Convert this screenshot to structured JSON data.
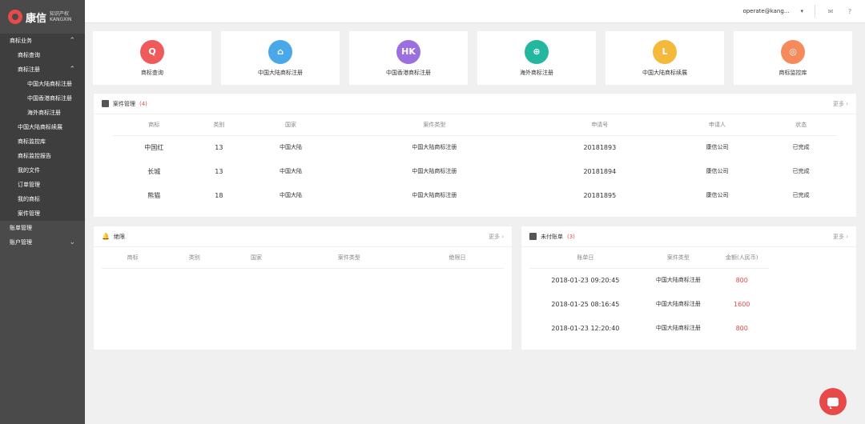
{
  "brand": {
    "name": "康信",
    "sub1": "知识产权",
    "sub2": "KANGXIN"
  },
  "nav": [
    {
      "label": "商标业务",
      "level": "group",
      "chev": "⌃"
    },
    {
      "label": "商标查询",
      "level": "l2"
    },
    {
      "label": "商标注册",
      "level": "l2",
      "chev": "⌃"
    },
    {
      "label": "中国大陆商标注册",
      "level": "l3"
    },
    {
      "label": "中国香港商标注册",
      "level": "l3"
    },
    {
      "label": "海外商标注册",
      "level": "l3"
    },
    {
      "label": "中国大陆商标续展",
      "level": "l2"
    },
    {
      "label": "商标监控库",
      "level": "l2"
    },
    {
      "label": "商标监控报告",
      "level": "l2"
    },
    {
      "label": "我的文件",
      "level": "l2"
    },
    {
      "label": "订单管理",
      "level": "l2"
    },
    {
      "label": "我的商标",
      "level": "l2"
    },
    {
      "label": "案件管理",
      "level": "l2"
    },
    {
      "label": "账单管理",
      "level": "top"
    },
    {
      "label": "账户管理",
      "level": "top",
      "chev": "⌄"
    }
  ],
  "topbar": {
    "user": "operate@kang...",
    "caret": "▾"
  },
  "quick": [
    {
      "label": "商标查询",
      "color": "#ef5b5b",
      "glyph": "Q"
    },
    {
      "label": "中国大陆商标注册",
      "color": "#4aa8e8",
      "glyph": "⌂"
    },
    {
      "label": "中国香港商标注册",
      "color": "#9c6fe0",
      "glyph": "HK"
    },
    {
      "label": "海外商标注册",
      "color": "#23b7a0",
      "glyph": "⊕"
    },
    {
      "label": "中国大陆商标续展",
      "color": "#f4b93a",
      "glyph": "L"
    },
    {
      "label": "商标监控库",
      "color": "#f58a5a",
      "glyph": "◎"
    }
  ],
  "cases": {
    "title": "案件管理",
    "count": "(4)",
    "more": "更多 ›",
    "headers": [
      "商标",
      "类别",
      "国家",
      "案件类型",
      "申请号",
      "申请人",
      "状态"
    ],
    "rows": [
      [
        "中国红",
        "13",
        "中国大陆",
        "中国大陆商标注册",
        "20181893",
        "康信公司",
        "已完成"
      ],
      [
        "长城",
        "13",
        "中国大陆",
        "中国大陆商标注册",
        "20181894",
        "康信公司",
        "已完成"
      ],
      [
        "熊猫",
        "18",
        "中国大陆",
        "中国大陆商标注册",
        "20181895",
        "康信公司",
        "已完成"
      ]
    ]
  },
  "deadline": {
    "title": "绝限",
    "more": "更多 ›",
    "headers": [
      "商标",
      "类别",
      "国家",
      "案件类型",
      "绝限日"
    ]
  },
  "bills": {
    "title": "未付账单",
    "count": "(3)",
    "more": "更多 ›",
    "headers": [
      "账单日",
      "案件类型",
      "金额(人民币)"
    ],
    "rows": [
      [
        "2018-01-23 09:20:45",
        "中国大陆商标注册",
        "800"
      ],
      [
        "2018-01-25 08:16:45",
        "中国大陆商标注册",
        "1600"
      ],
      [
        "2018-01-23 12:20:40",
        "中国大陆商标注册",
        "800"
      ]
    ]
  }
}
